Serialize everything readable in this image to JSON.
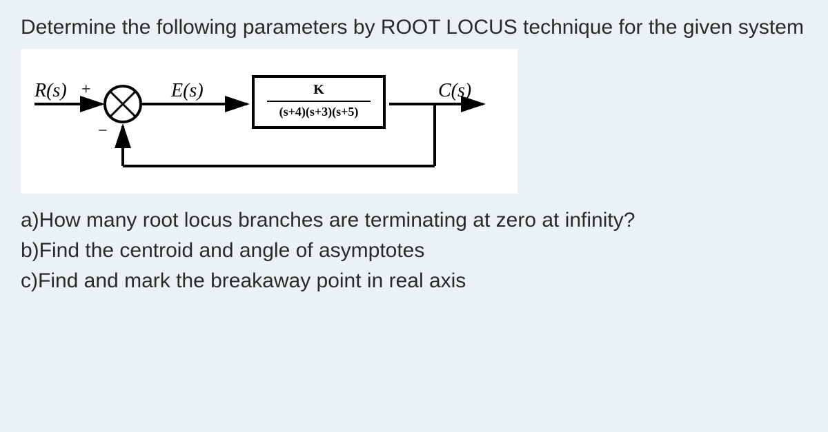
{
  "prompt": "Determine the following parameters by ROOT   LOCUS technique for the given system",
  "diagram": {
    "input_label": "R(s)",
    "plus": "+",
    "minus": "−",
    "error_label": "E(s)",
    "output_label": "C(s)",
    "tf_numerator": "K",
    "tf_denominator": "(s+4)(s+3)(s+5)"
  },
  "questions": {
    "a": "a)How many root locus branches are terminating at zero at infinity?",
    "b": "b)Find the centroid and angle of asymptotes",
    "c": "c)Find and mark the breakaway point in real axis"
  }
}
